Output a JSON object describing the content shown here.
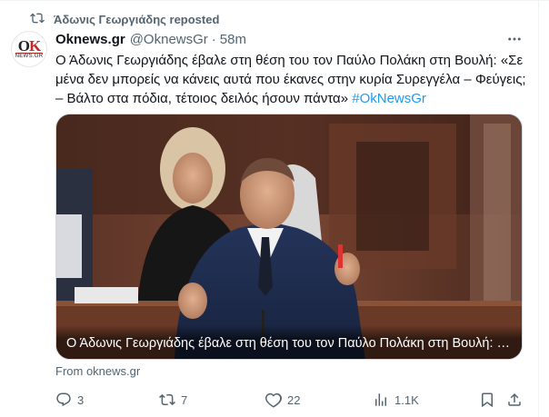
{
  "repost": {
    "label": "Άδωνις Γεωργιάδης reposted",
    "icon": "repost-icon"
  },
  "author": {
    "name": "Oknews.gr",
    "handle": "@OknewsGr",
    "separator": "·",
    "time": "58m",
    "avatar": {
      "icon": "oknews-logo",
      "logo_text": "OK",
      "logo_sub": "NEWS.GR"
    }
  },
  "tweet": {
    "text": "Ο Άδωνις Γεωργιάδης έβαλε στη θέση του τον Παύλο Πολάκη στη Βουλή: «Σε μένα δεν μπορείς να κάνεις αυτά που έκανες στην κυρία Συρεγγέλα – Φεύγεις; – Βάλτο στα πόδια, τέτοιος δειλός ήσουν πάντα» ",
    "hashtag": "#OkNewsGr"
  },
  "media": {
    "caption": "Ο Άδωνις Γεωργιάδης έβαλε στη θέση του τον Παύλο Πολάκη στη Βουλή: «Σε μέ..."
  },
  "source": "From oknews.gr",
  "actions": {
    "reply": {
      "icon": "reply-icon",
      "count": "3"
    },
    "repost": {
      "icon": "repost-icon",
      "count": "7"
    },
    "like": {
      "icon": "heart-icon",
      "count": "22"
    },
    "views": {
      "icon": "views-icon",
      "count": "1.1K"
    },
    "bookmark": {
      "icon": "bookmark-icon"
    },
    "share": {
      "icon": "share-icon"
    }
  },
  "colors": {
    "accent": "#1d9bf0",
    "muted": "#536471",
    "text": "#0f1419"
  }
}
